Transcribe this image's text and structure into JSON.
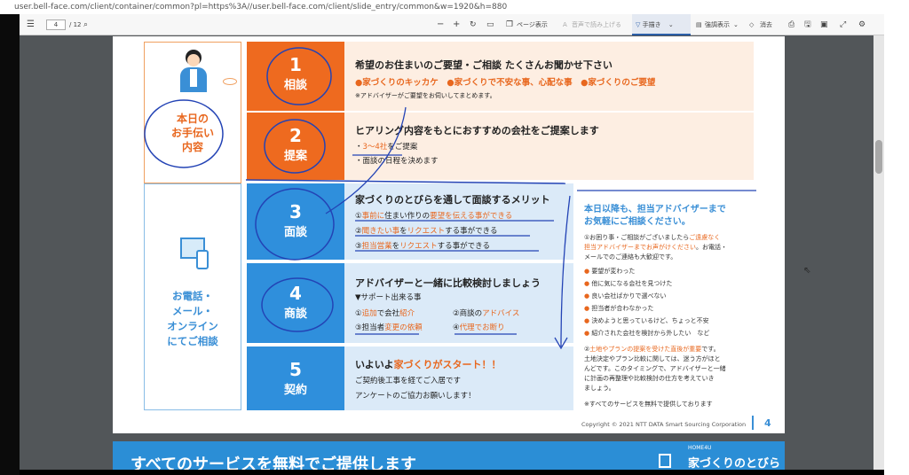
{
  "browser": {
    "url": "user.bell-face.com/client/container/common?pl=https%3A//user.bell-face.com/client/slide_entry/common&w=1920&h=880"
  },
  "toolbar": {
    "page_current": "4",
    "page_total": "/ 12",
    "page_view": "ページ表示",
    "read_aloud": "音声で読み上げる",
    "draw": "手描き",
    "highlight": "強調表示",
    "erase": "消去"
  },
  "slide": {
    "left_title": [
      "本日の",
      "お手伝い",
      "内容"
    ],
    "left_bottom": [
      "お電話・",
      "メール・",
      "オンライン",
      "にてご相談"
    ],
    "steps": [
      {
        "num": "1",
        "label": "相談"
      },
      {
        "num": "2",
        "label": "提案"
      },
      {
        "num": "3",
        "label": "面談"
      },
      {
        "num": "4",
        "label": "商談"
      },
      {
        "num": "5",
        "label": "契約"
      }
    ],
    "s1": {
      "head": "希望のお住まいのご要望・ご相談 たくさんお聞かせ下さい",
      "b1": "●家づくりのキッカケ",
      "b2": "●家づくりで不安な事、心配な事",
      "b3": "●家づくりのご要望",
      "note": "※アドバイザーがご要望をお伺いしてまとめます。"
    },
    "s2": {
      "head": "ヒアリング内容をもとにおすすめの会社をご提案します",
      "l1a": "・",
      "l1b": "3～4社",
      "l1c": "をご提案",
      "l2": "・面談の日程を決めます"
    },
    "s3": {
      "head": "家づくりのとびらを通して面談するメリット",
      "l1a": "①",
      "l1b": "事前に",
      "l1c": "住まい作りの",
      "l1d": "要望を伝える事ができる",
      "l2a": "②",
      "l2b": "聞きたい事",
      "l2c": "を",
      "l2d": "リクエスト",
      "l2e": "する事ができる",
      "l3a": "③",
      "l3b": "担当営業",
      "l3c": "を",
      "l3d": "リクエスト",
      "l3e": "する事ができる"
    },
    "s4": {
      "head": "アドバイザーと一緒に比較検討しましょう",
      "sub": "▼サポート出来る事",
      "c1a": "①",
      "c1b": "追加",
      "c1c": "で会社",
      "c1d": "紹介",
      "c2a": "②商談の",
      "c2b": "アドバイス",
      "c3a": "③担当者",
      "c3b": "変更の依頼",
      "c4a": "④",
      "c4b": "代理でお断り"
    },
    "s5": {
      "head_a": "いよいよ",
      "head_b": "家づくりがスタート！！",
      "l1": "ご契約後工事を経てご入居です",
      "l2": "アンケートのご協力お願いします！"
    },
    "right": {
      "title1": "本日以降も、担当アドバイザーまで",
      "title2": "お気軽にご相談ください。",
      "p1a": "①お困り事・ご相談がございましたら",
      "p1b": "ご遠慮なく",
      "p1c": "担当アドバイザーまでお声がけください",
      "p1d": "。お電話・",
      "p1e": "メールでのご連絡も大歓迎です。",
      "bullets": [
        "要望が変わった",
        "他に気になる会社を見つけた",
        "良い会社ばかりで選べない",
        "担当者が合わなかった",
        "決めようと思っているけど、ちょっと不安",
        "紹介された会社を検討から外したい　など"
      ],
      "p2a": "②",
      "p2b": "土地やプランの提案を受けた直後が重要",
      "p2c": "です。",
      "p2d": "土地決定やプラン比較に関しては、迷う方がほと",
      "p2e": "んどです。このタイミングで、アドバイザーと一緒",
      "p2f": "に計画の再整理や比較検討の仕方を考えていき",
      "p2g": "ましょう。",
      "note": "※すべてのサービスを無料で提供しております"
    },
    "copyright": "Copyright © 2021 NTT DATA Smart Sourcing Corporation",
    "page_no": "4"
  },
  "next_slide": {
    "banner": "すべてのサービスを無料でご提供します",
    "logo": "HOME4U",
    "logo_sub": "家づくりのとびら"
  }
}
